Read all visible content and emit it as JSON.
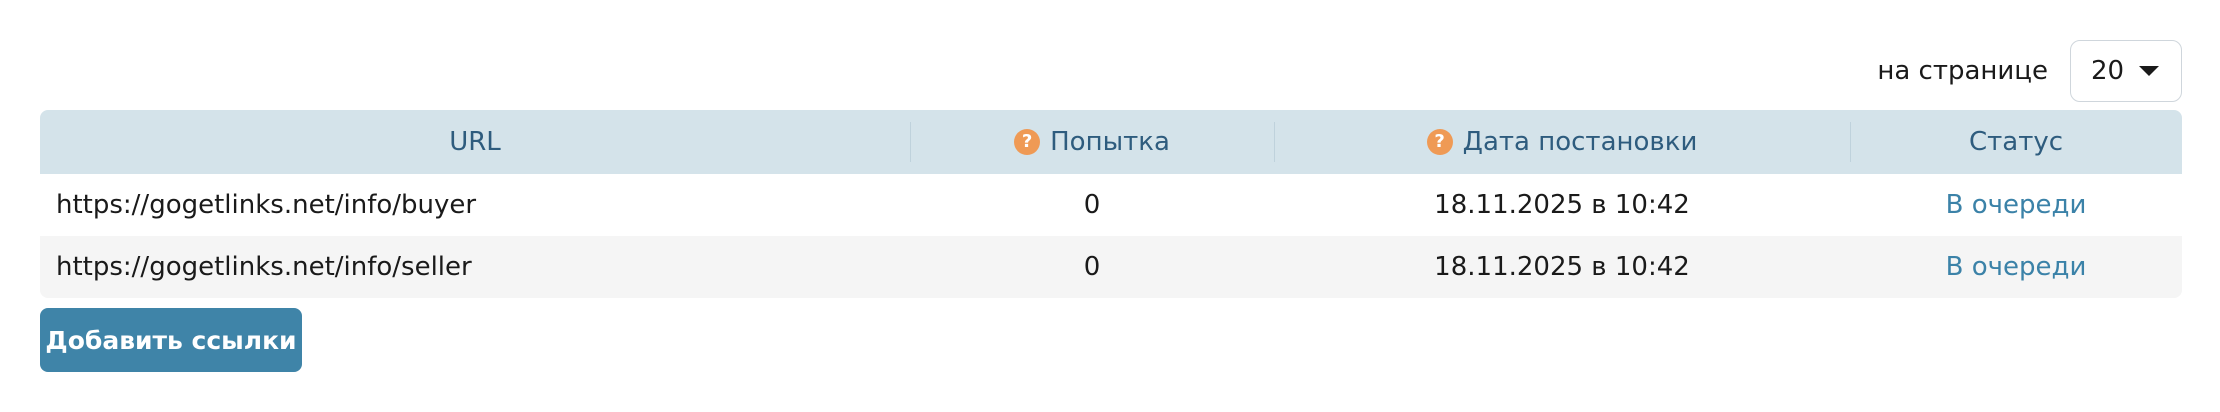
{
  "pagination": {
    "label": "на странице",
    "per_page_value": "20"
  },
  "table": {
    "headers": {
      "url": "URL",
      "attempt": "Попытка",
      "date": "Дата постановки",
      "status": "Статус"
    },
    "help_icon_glyph": "?",
    "rows": [
      {
        "url": "https://gogetlinks.net/info/buyer",
        "attempt": "0",
        "date": "18.11.2025 в 10:42",
        "status": "В очереди"
      },
      {
        "url": "https://gogetlinks.net/info/seller",
        "attempt": "0",
        "date": "18.11.2025 в 10:42",
        "status": "В очереди"
      }
    ]
  },
  "actions": {
    "add_links_label": "Добавить ссылки"
  },
  "colors": {
    "header_bg": "#d4e3ea",
    "header_text": "#2e5c7e",
    "help_icon": "#ef9a55",
    "status_link": "#3b82a8",
    "button_bg": "#3f84a8"
  },
  "icons": {
    "help": "help-icon",
    "dropdown": "chevron-down-icon"
  }
}
